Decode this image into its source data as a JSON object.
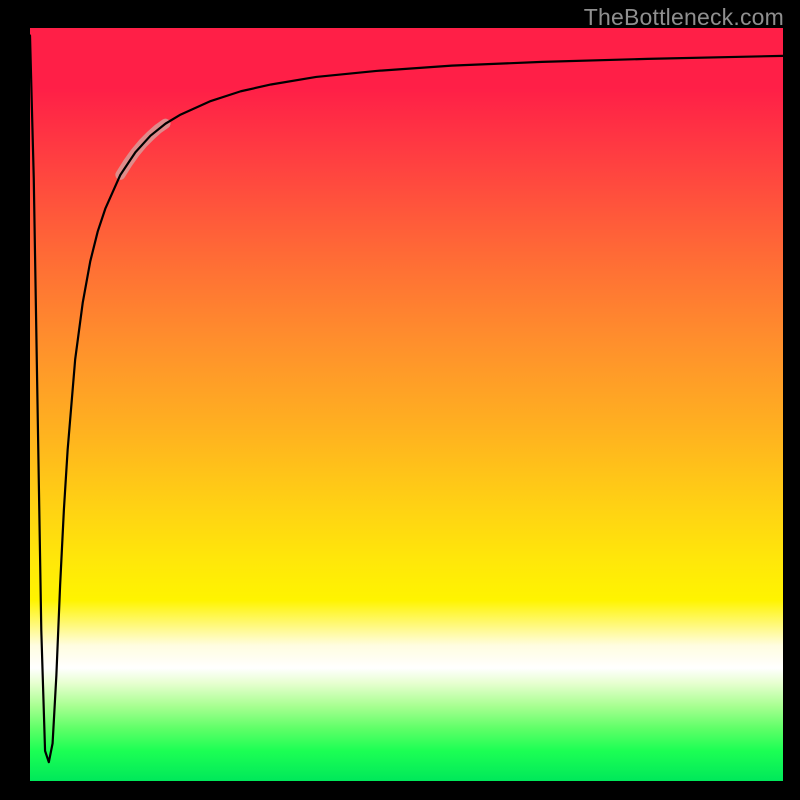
{
  "watermark": {
    "text": "TheBottleneck.com"
  },
  "chart_data": {
    "type": "line",
    "title": "",
    "xlabel": "",
    "ylabel": "",
    "xlim": [
      0,
      100
    ],
    "ylim": [
      0,
      100
    ],
    "grid": false,
    "legend": false,
    "annotations": [],
    "background_gradient": {
      "type": "vertical",
      "stops": [
        {
          "pos": 0.0,
          "color": "#ff1f47"
        },
        {
          "pos": 0.16,
          "color": "#ff3a42"
        },
        {
          "pos": 0.3,
          "color": "#ff6a36"
        },
        {
          "pos": 0.42,
          "color": "#ff902c"
        },
        {
          "pos": 0.54,
          "color": "#ffb31f"
        },
        {
          "pos": 0.64,
          "color": "#ffd313"
        },
        {
          "pos": 0.76,
          "color": "#fff400"
        },
        {
          "pos": 0.85,
          "color": "#ffffff"
        },
        {
          "pos": 0.93,
          "color": "#5fff68"
        },
        {
          "pos": 1.0,
          "color": "#00e85a"
        }
      ]
    },
    "series": [
      {
        "name": "bottleneck-curve",
        "stroke": "#000000",
        "stroke_width": 2.2,
        "x": [
          0.0,
          0.5,
          1.0,
          1.5,
          2.0,
          2.5,
          3.0,
          3.5,
          4.0,
          4.5,
          5.0,
          6.0,
          7.0,
          8.0,
          9.0,
          10.0,
          12.0,
          14.0,
          16.0,
          18.0,
          20.0,
          24.0,
          28.0,
          32.0,
          38.0,
          46.0,
          56.0,
          68.0,
          82.0,
          100.0
        ],
        "y": [
          99.0,
          80.0,
          50.0,
          20.0,
          4.0,
          2.5,
          5.0,
          14.0,
          26.0,
          36.0,
          44.0,
          56.0,
          63.5,
          69.0,
          73.0,
          76.0,
          80.5,
          83.5,
          85.7,
          87.3,
          88.5,
          90.3,
          91.6,
          92.5,
          93.5,
          94.3,
          95.0,
          95.5,
          95.9,
          96.3
        ]
      },
      {
        "name": "highlight-segment",
        "stroke": "#d99a98",
        "stroke_width": 10,
        "opacity": 0.85,
        "x": [
          12.0,
          13.0,
          14.0,
          15.0,
          16.0,
          17.0,
          18.0
        ],
        "y": [
          80.5,
          82.1,
          83.5,
          84.7,
          85.7,
          86.6,
          87.3
        ]
      }
    ]
  }
}
